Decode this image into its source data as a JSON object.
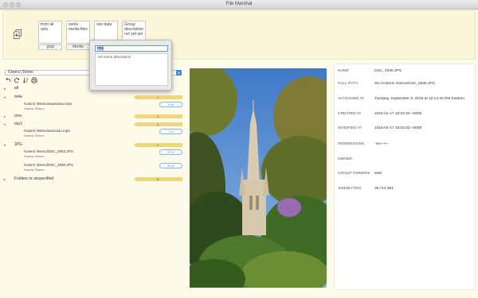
{
  "window": {
    "title": "File Marshal"
  },
  "sets": [
    {
      "description": "from all sets",
      "label": ".jpgs"
    },
    {
      "description": "some media files",
      "label": "Media"
    },
    {
      "description": "raw data",
      "label": ""
    },
    {
      "description": "Group description not yet set",
      "label": ""
    }
  ],
  "popover": {
    "input_value": "mia",
    "description_placeholder": "set some description"
  },
  "browser": {
    "path": "/Users/ /Demo",
    "tree": [
      {
        "ext": "aif",
        "count": ""
      },
      {
        "ext": "m4a",
        "count": "1",
        "files": [
          {
            "path": "/Users/ /Demo/assession.m4a",
            "dir": "/Users/ /Demo",
            "size": "6 M"
          }
        ]
      },
      {
        "ext": "mov",
        "count": "1"
      },
      {
        "ext": "mp3",
        "count": "1",
        "files": [
          {
            "path": "/Users/ /Demo/assesion.mp3",
            "dir": "/Users/ /Demo",
            "size": "1 M"
          }
        ]
      },
      {
        "ext": "JPG",
        "count": "2",
        "files": [
          {
            "path": "/Users/ /Demo/DSC_2903.JPG",
            "dir": "/Users/ /Demo",
            "size": "23 M"
          },
          {
            "path": "/Users/ /Demo/DSC_2930.JPG",
            "dir": "/Users/ /Demo",
            "size": "36 M"
          }
        ]
      },
      {
        "ext": "Folders or unspecified",
        "count": "3"
      }
    ]
  },
  "info": [
    {
      "key": "NAME",
      "value": "DSC_2930.JPG"
    },
    {
      "key": "FULL PATH",
      "value": "file:///Users/ /Demo/DSC_2930.JPG"
    },
    {
      "key": "ACCESSED AT",
      "value": "Tuesday, September 8, 2015 at 10:14:34 PM Eastern"
    },
    {
      "key": "CREATED AT",
      "value": "2015-04-17 18:02:40 +0000"
    },
    {
      "key": "MODIFIED AT",
      "value": "2015-04-17 18:02:53 +0000"
    },
    {
      "key": "PERMISSIONS",
      "value": "-rw-r--r--"
    },
    {
      "key": "OWNER",
      "value": ""
    },
    {
      "key": "GROUP OWNERS",
      "value": "staff"
    },
    {
      "key": "SIZE(BYTES)",
      "value": "36,714,961"
    }
  ]
}
